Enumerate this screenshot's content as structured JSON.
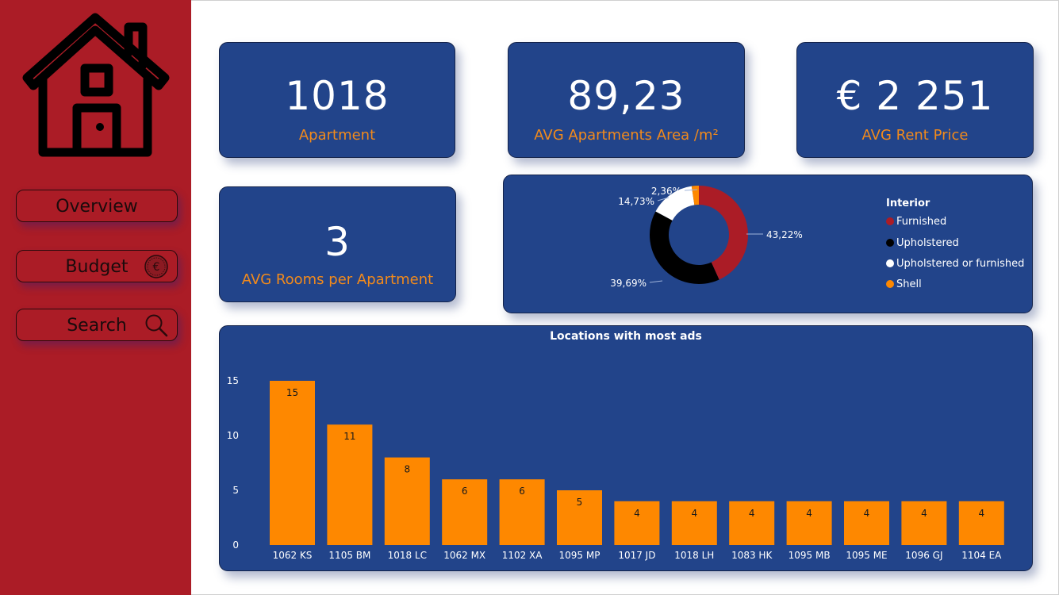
{
  "nav": {
    "items": [
      {
        "label": "Overview",
        "icon": "none"
      },
      {
        "label": "Budget",
        "icon": "euro-coin-icon"
      },
      {
        "label": "Search",
        "icon": "search-icon"
      }
    ]
  },
  "kpis": [
    {
      "value": "1018",
      "label": "Apartment"
    },
    {
      "value": "89,23",
      "label": "AVG Apartments Area /m²"
    },
    {
      "value": "€ 2 251",
      "label": "AVG Rent Price"
    },
    {
      "value": "3",
      "label": "AVG Rooms per Apartment"
    }
  ],
  "colors": {
    "sidebar": "#ab1c26",
    "card": "#22448a",
    "accent": "#f28a1b",
    "bar": "#fe8800"
  },
  "chart_data": [
    {
      "type": "pie",
      "legend_title": "Interior",
      "legend_position": "right",
      "slices": [
        {
          "name": "Furnished",
          "value": 43.22,
          "label": "43,22%",
          "color": "#ab1c26"
        },
        {
          "name": "Upholstered",
          "value": 39.69,
          "label": "39,69%",
          "color": "#000000"
        },
        {
          "name": "Upholstered or furnished",
          "value": 14.73,
          "label": "14,73%",
          "color": "#ffffff"
        },
        {
          "name": "Shell",
          "value": 2.36,
          "label": "2,36%",
          "color": "#fe8800"
        }
      ]
    },
    {
      "type": "bar",
      "title": "Locations with most ads",
      "categories": [
        "1062 KS",
        "1105 BM",
        "1018 LC",
        "1062 MX",
        "1102 XA",
        "1095 MP",
        "1017 JD",
        "1018 LH",
        "1083 HK",
        "1095 MB",
        "1095 ME",
        "1096 GJ",
        "1104 EA"
      ],
      "values": [
        15,
        11,
        8,
        6,
        6,
        5,
        4,
        4,
        4,
        4,
        4,
        4,
        4
      ],
      "yticks": [
        0,
        5,
        10,
        15
      ],
      "ylim": [
        0,
        15
      ],
      "grid": false,
      "bar_color": "#fe8800"
    }
  ]
}
